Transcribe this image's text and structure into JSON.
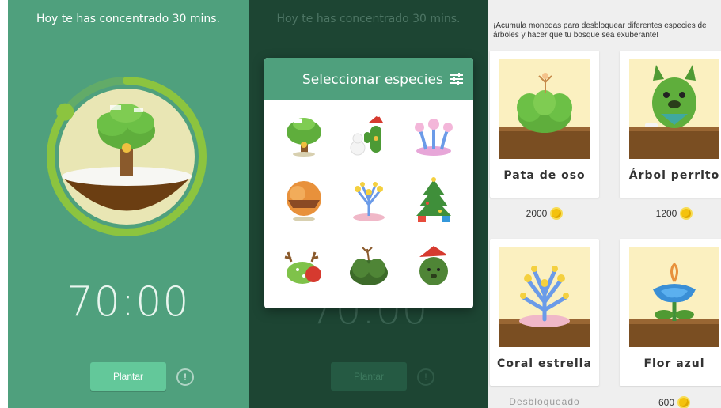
{
  "timer_screen": {
    "status_message": "Hoy te has concentrado 30 mins.",
    "time": "70:00",
    "plant_button": "Plantar",
    "info_icon": "!",
    "progress": 0.85
  },
  "species_dialog": {
    "background_status": "Hoy te has concentrado 30 mins.",
    "background_time": "70:00",
    "background_button": "Plantar",
    "title": "Seleccionar especies",
    "filter_icon": "sliders-icon",
    "species": [
      "christmas-tree-house",
      "snowman-cactus",
      "pink-coral",
      "autumn-orange-tree",
      "star-coral",
      "christmas-tree",
      "reindeer-bush",
      "bear-paw",
      "christmas-dog"
    ]
  },
  "store": {
    "message": "¡Acumula monedas para desbloquear diferentes especies de árboles y hacer que tu bosque sea exuberante!",
    "items": [
      {
        "name": "Pata de oso",
        "price": "2000"
      },
      {
        "name": "Árbol perrito",
        "price": "1200"
      },
      {
        "name": "Coral estrella",
        "status": "Desbloqueado"
      },
      {
        "name": "Flor azul",
        "price": "600"
      }
    ]
  },
  "colors": {
    "primary_green": "#4fa07d",
    "dark_overlay": "#1d4533",
    "button_green": "#63c89a",
    "coin": "#f4c20d"
  }
}
